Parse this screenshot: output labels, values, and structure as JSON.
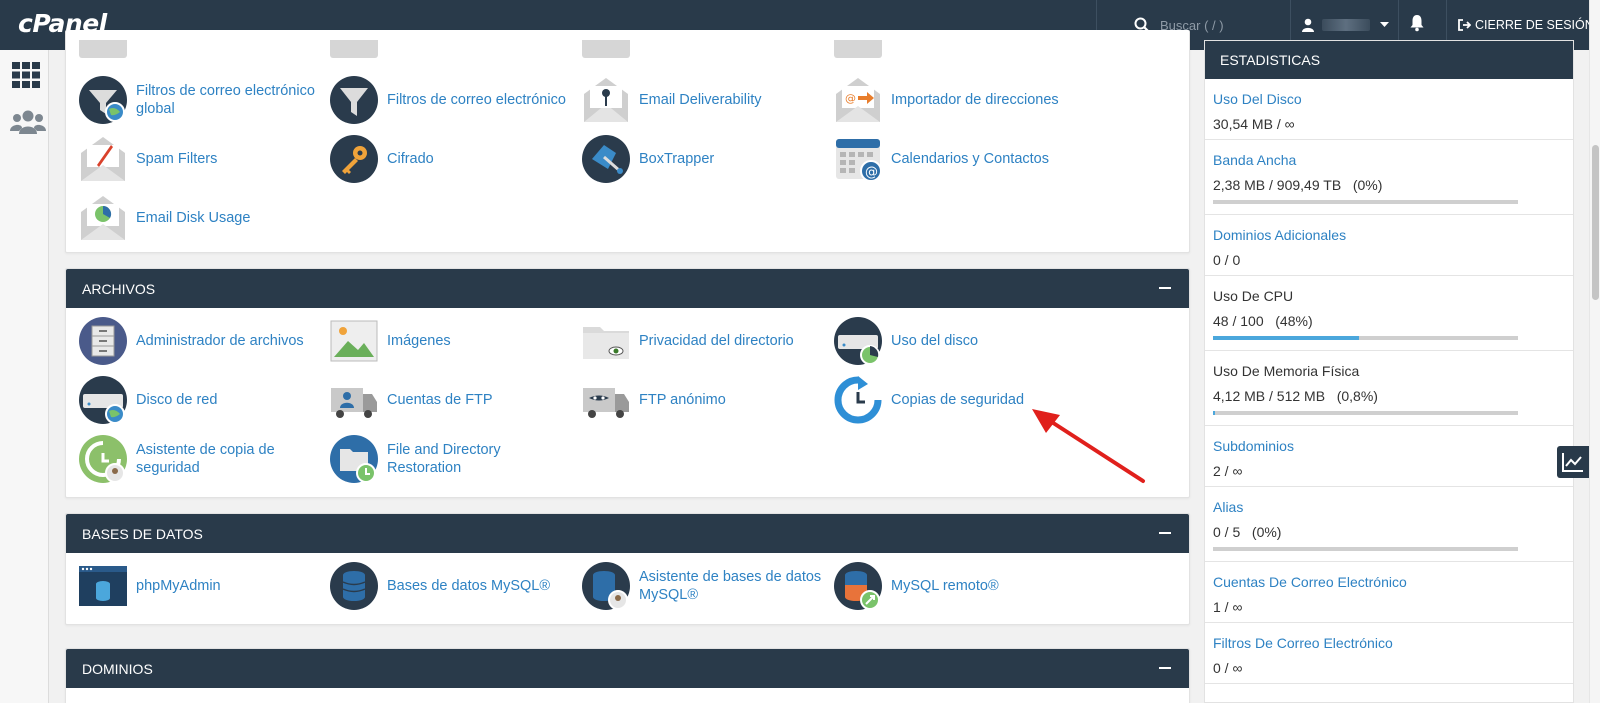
{
  "topbar": {
    "logo": "cPanel",
    "search_placeholder": "Buscar ( / )",
    "logout_label": "CIERRE DE SESIÓN"
  },
  "sections": [
    {
      "title": "",
      "items": [
        {
          "label": "Filtros de correo electrónico global",
          "icon": "global-email-filter-icon"
        },
        {
          "label": "Filtros de correo electrónico",
          "icon": "email-filter-icon"
        },
        {
          "label": "Email Deliverability",
          "icon": "email-deliverability-icon"
        },
        {
          "label": "Importador de direcciones",
          "icon": "address-importer-icon"
        },
        {
          "label": "Spam Filters",
          "icon": "spam-filters-icon"
        },
        {
          "label": "Cifrado",
          "icon": "encryption-key-icon"
        },
        {
          "label": "BoxTrapper",
          "icon": "boxtrapper-icon"
        },
        {
          "label": "Calendarios y Contactos",
          "icon": "calendar-contacts-icon"
        },
        {
          "label": "Email Disk Usage",
          "icon": "email-disk-usage-icon"
        }
      ]
    },
    {
      "title": "ARCHIVOS",
      "items": [
        {
          "label": "Administrador de archivos",
          "icon": "file-manager-icon"
        },
        {
          "label": "Imágenes",
          "icon": "images-icon"
        },
        {
          "label": "Privacidad del directorio",
          "icon": "directory-privacy-icon"
        },
        {
          "label": "Uso del disco",
          "icon": "disk-usage-icon"
        },
        {
          "label": "Disco de red",
          "icon": "network-disk-icon"
        },
        {
          "label": "Cuentas de FTP",
          "icon": "ftp-accounts-icon"
        },
        {
          "label": "FTP anónimo",
          "icon": "anonymous-ftp-icon"
        },
        {
          "label": "Copias de seguridad",
          "icon": "backup-icon"
        },
        {
          "label": "Asistente de copia de seguridad",
          "icon": "backup-wizard-icon"
        },
        {
          "label": "File and Directory Restoration",
          "icon": "file-restoration-icon"
        }
      ]
    },
    {
      "title": "BASES DE DATOS",
      "items": [
        {
          "label": "phpMyAdmin",
          "icon": "phpmyadmin-icon"
        },
        {
          "label": "Bases de datos MySQL®",
          "icon": "mysql-databases-icon"
        },
        {
          "label": "Asistente de bases de datos MySQL®",
          "icon": "mysql-wizard-icon"
        },
        {
          "label": "MySQL remoto®",
          "icon": "remote-mysql-icon"
        }
      ]
    },
    {
      "title": "DOMINIOS",
      "items": []
    }
  ],
  "stats": {
    "title": "ESTADISTICAS",
    "items": [
      {
        "label": "Uso Del Disco",
        "value": "30,54 MB / ∞",
        "link": true
      },
      {
        "label": "Banda Ancha",
        "value": "2,38 MB / 909,49 TB   (0%)",
        "link": true,
        "bar": 0
      },
      {
        "label": "Dominios Adicionales",
        "value": "0 / 0",
        "link": true
      },
      {
        "label": "Uso De CPU",
        "value": "48 / 100   (48%)",
        "link": false,
        "bar": 0.48
      },
      {
        "label": "Uso De Memoria Física",
        "value": "4,12 MB / 512 MB   (0,8%)",
        "link": false,
        "bar": 0.008
      },
      {
        "label": "Subdominios",
        "value": "2 / ∞",
        "link": true
      },
      {
        "label": "Alias",
        "value": "0 / 5   (0%)",
        "link": true,
        "bar": 0
      },
      {
        "label": "Cuentas De Correo Electrónico",
        "value": "1 / ∞",
        "link": true
      },
      {
        "label": "Filtros De Correo Electrónico",
        "value": "0 / ∞",
        "link": true
      }
    ]
  },
  "colors": {
    "navy": "#293a4a",
    "link": "#2e82c3",
    "annotation_arrow": "#e0201c"
  }
}
